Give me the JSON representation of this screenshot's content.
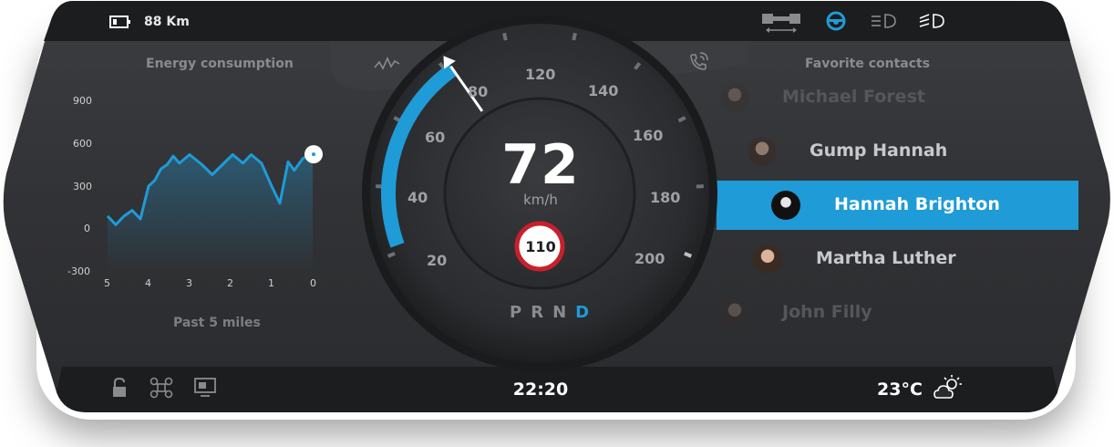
{
  "status_bar": {
    "range_value": "88 Km",
    "icons": [
      "battery-icon",
      "seatbelt-icon",
      "steering-wheel-icon",
      "low-beam-icon",
      "high-beam-icon"
    ],
    "accent_color": "#1f9bd7"
  },
  "energy": {
    "title": "Energy consumption",
    "footer": "Past 5 miles",
    "chart_data": {
      "type": "line",
      "title": "Energy consumption",
      "xlabel": "Past 5 miles",
      "ylabel": "",
      "x_ticks": [
        "5",
        "4",
        "3",
        "2",
        "1",
        "0"
      ],
      "y_ticks": [
        "900",
        "600",
        "300",
        "0",
        "-300"
      ],
      "ylim": [
        -300,
        900
      ],
      "xlim": [
        5,
        0
      ],
      "grid": false,
      "series": [
        {
          "x": [
            5.0,
            4.8,
            4.6,
            4.4,
            4.2,
            4.0,
            3.85,
            3.7,
            3.55,
            3.4,
            3.25,
            3.0,
            2.7,
            2.45,
            2.2,
            1.95,
            1.7,
            1.5,
            1.25,
            1.0,
            0.8,
            0.6,
            0.45,
            0.25,
            0.15,
            0.0
          ],
          "values": [
            90,
            30,
            90,
            130,
            70,
            300,
            340,
            420,
            450,
            510,
            460,
            520,
            450,
            380,
            450,
            520,
            460,
            520,
            460,
            300,
            180,
            470,
            410,
            490,
            510,
            510
          ],
          "color": "#1f9bd7"
        }
      ]
    }
  },
  "speedometer": {
    "speed": "72",
    "unit": "km/h",
    "speed_value": 72,
    "max_scale": 200,
    "scale_labels": [
      "20",
      "40",
      "60",
      "80",
      "120",
      "140",
      "160",
      "180",
      "200"
    ],
    "speed_limit": "110",
    "gears": [
      "P",
      "R",
      "N",
      "D"
    ],
    "active_gear": "D"
  },
  "contacts": {
    "title": "Favorite contacts",
    "items": [
      {
        "name": "Michael Forest"
      },
      {
        "name": "Gump Hannah"
      },
      {
        "name": "Hannah Brighton"
      },
      {
        "name": "Martha Luther"
      },
      {
        "name": "John Filly"
      }
    ],
    "selected": "Hannah Brighton"
  },
  "bottom_bar": {
    "time": "22:20",
    "temperature": "23°C",
    "left_icons": [
      "lock-icon",
      "drone-icon",
      "camera-icon"
    ],
    "weather_icon": "partly-cloudy-icon"
  }
}
